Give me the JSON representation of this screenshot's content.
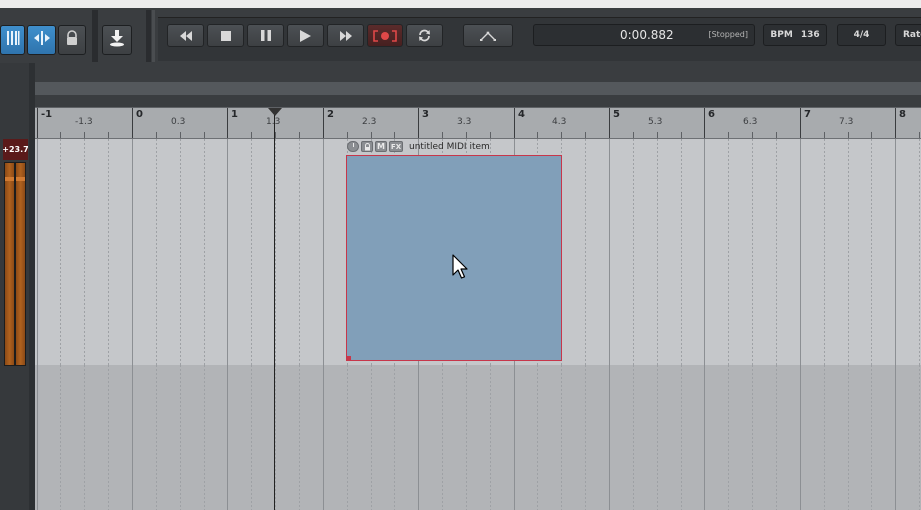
{
  "transport": {
    "time": "0:00.882",
    "state": "[Stopped]",
    "bpm_label": "BPM",
    "bpm_value": "136",
    "time_signature": "4/4",
    "rate_label": "Rate"
  },
  "track": {
    "meter_peak": "+23.7"
  },
  "item": {
    "name": "untitled MIDI item",
    "header_buttons": [
      "M",
      "FX"
    ]
  },
  "ruler": {
    "major": [
      "-1",
      "0",
      "1",
      "2",
      "3",
      "4",
      "5",
      "6",
      "7",
      "8"
    ],
    "minor": [
      "-1.3",
      "0.3",
      "1.3",
      "2.3",
      "3.3",
      "4.3",
      "5.3",
      "6.3",
      "7.3"
    ]
  },
  "colors": {
    "midi_item": "#819fb9",
    "item_border": "#c7364a",
    "active_button": "#3f8fcc",
    "meter": "#b0621f"
  },
  "icons": [
    "grid-icon",
    "ripple-icon",
    "lock-icon",
    "download-icon",
    "rewind-icon",
    "stop-icon",
    "pause-icon",
    "play-icon",
    "fast-forward-icon",
    "record-icon",
    "loop-icon",
    "envelope-icon"
  ]
}
